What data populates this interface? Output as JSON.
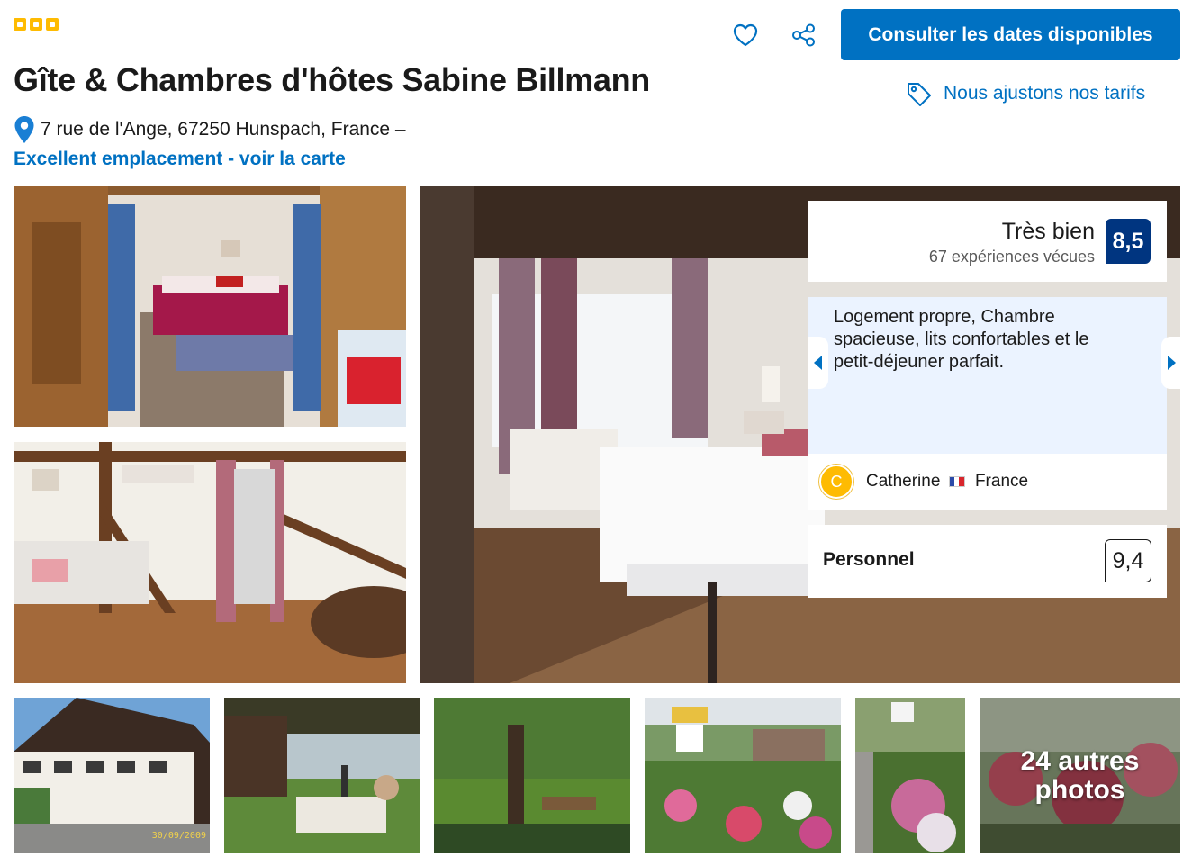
{
  "header": {
    "star_rating": 3,
    "title": "Gîte & Chambres d'hôtes Sabine Billmann",
    "address": "7 rue de l'Ange, 67250 Hunspach, France –",
    "map_link": "Excellent emplacement - voir la carte",
    "cta_label": "Consulter les dates disponibles",
    "price_match": "Nous ajustons nos tarifs",
    "favorite_icon": "heart-icon",
    "share_icon": "share-icon",
    "accent_color": "#0071c2"
  },
  "gallery": {
    "more_photos": "24 autres photos",
    "thumb_date_stamp": "30/09/2009"
  },
  "score": {
    "label": "Très bien",
    "reviews": "67 expériences vécues",
    "value": "8,5",
    "badge_color": "#003580"
  },
  "review": {
    "text": "Logement propre, Chambre spacieuse, lits confortables et le petit-déjeuner parfait.",
    "avatar_initial": "C",
    "author": "Catherine",
    "country": "France"
  },
  "staff": {
    "label": "Personnel",
    "score": "9,4"
  }
}
